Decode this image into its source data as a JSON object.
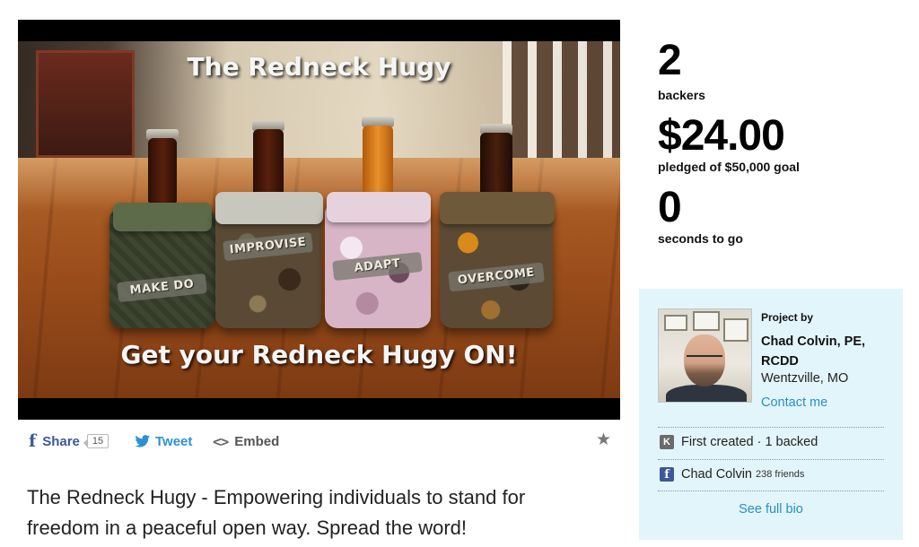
{
  "video": {
    "title_overlay": "The Redneck Hugy",
    "caption_overlay": "Get your Redneck Hugy ON!",
    "bottle_bands": [
      "MAKE DO",
      "IMPROVISE",
      "ADAPT",
      "OVERCOME"
    ]
  },
  "share_bar": {
    "facebook_label": "Share",
    "facebook_count": "15",
    "tweet_label": "Tweet",
    "embed_label": "Embed",
    "icons": [
      "facebook-icon",
      "twitter-icon",
      "embed-icon",
      "star-icon"
    ]
  },
  "blurb": "The Redneck Hugy - Empowering individuals to stand for freedom in a peaceful open way. Spread the word!",
  "stats": {
    "backers_count": "2",
    "backers_label": "backers",
    "pledged_amount": "$24.00",
    "pledged_label": "pledged of $50,000 goal",
    "time_value": "0",
    "time_label": "seconds to go"
  },
  "creator": {
    "project_by_label": "Project by",
    "name": "Chad Colvin, PE, RCDD",
    "location": "Wentzville, MO",
    "contact_label": "Contact me",
    "history": "First created · 1 backed",
    "facebook_name": "Chad Colvin",
    "facebook_friends": "238 friends",
    "full_bio_label": "See full bio"
  },
  "colors": {
    "link_blue": "#2a8fc1",
    "facebook_blue": "#3b5998",
    "twitter_blue": "#2b91d6",
    "card_background": "#e2f5fa"
  }
}
